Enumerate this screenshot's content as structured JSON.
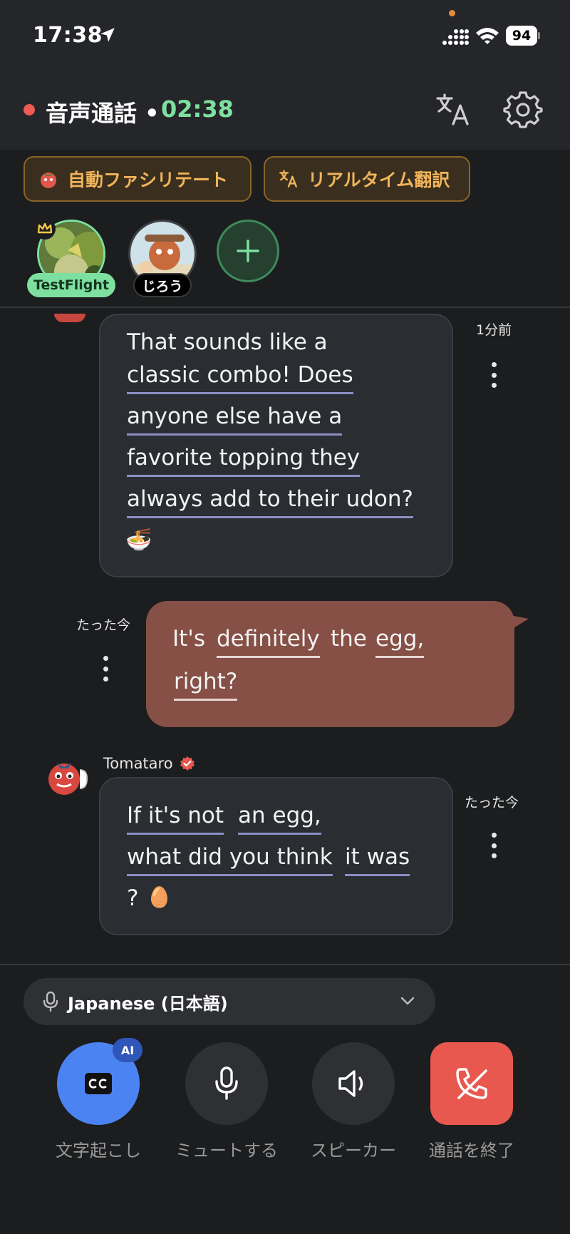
{
  "status_bar": {
    "time": "17:38",
    "battery": "94"
  },
  "header": {
    "title": "音声通話 •",
    "elapsed": "02:38"
  },
  "chips": {
    "facilitate": "自動ファシリテート",
    "translate": "リアルタイム翻訳"
  },
  "participants": [
    {
      "name": "TestFlight"
    },
    {
      "name": "じろう"
    }
  ],
  "messages": {
    "m1": {
      "timestamp": "1分前",
      "lines": [
        "That sounds like a",
        "classic combo! Does",
        "anyone else have a",
        "favorite topping they",
        "always add to their udon?"
      ],
      "emoji": "🍜"
    },
    "m2": {
      "timestamp": "たった今",
      "line1_a": "It's",
      "line1_b": "definitely",
      "line1_c": "the",
      "line1_d": "egg,",
      "line2": "right?"
    },
    "m3": {
      "sender": "Tomataro",
      "timestamp": "たった今",
      "line1_a": "If it's not",
      "line1_b": "an egg,",
      "line2_a": "what did you think",
      "line2_b": "it was",
      "line3": "?",
      "emoji": "🥚"
    }
  },
  "language": {
    "selected": "Japanese (日本語)"
  },
  "controls": {
    "transcribe": "文字起こし",
    "ai_badge": "AI",
    "mute": "ミュートする",
    "speaker": "スピーカー",
    "end": "通話を終了"
  },
  "colors": {
    "accent_green": "#7ee0a0",
    "record_red": "#ee5a55",
    "chip_orange": "#f0b45a",
    "outgoing_bubble": "#865046",
    "transcribe_blue": "#4b84f2",
    "end_red": "#e8584f"
  }
}
